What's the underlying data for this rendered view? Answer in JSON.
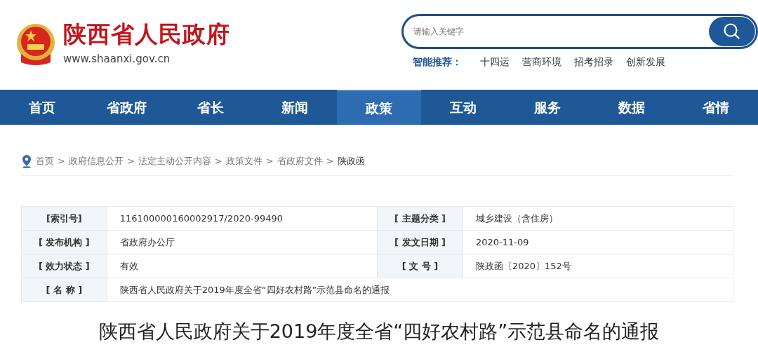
{
  "header": {
    "site_name": "陕西省人民政府",
    "url": "www.shaanxi.gov.cn"
  },
  "search": {
    "placeholder": "请输入关键字"
  },
  "recommend": {
    "label": "智能推荐：",
    "items": [
      "十四运",
      "营商环境",
      "招考招录",
      "创新发展"
    ]
  },
  "nav": [
    {
      "label": "首页",
      "selected": false
    },
    {
      "label": "省政府",
      "selected": false
    },
    {
      "label": "省长",
      "selected": false
    },
    {
      "label": "新闻",
      "selected": false
    },
    {
      "label": "政策",
      "selected": true
    },
    {
      "label": "互动",
      "selected": false
    },
    {
      "label": "服务",
      "selected": false
    },
    {
      "label": "数据",
      "selected": false
    },
    {
      "label": "省情",
      "selected": false
    }
  ],
  "breadcrumb_separator": ">",
  "breadcrumb": [
    "首页",
    "政府信息公开",
    "法定主动公开内容",
    "政策文件",
    "省政府文件",
    "陕政函"
  ],
  "info_table": [
    [
      {
        "label": "[索引号]",
        "value": "116100000160002917/2020-99490"
      },
      {
        "label": "[ 主题分类 ]",
        "value": "城乡建设（含住房）"
      }
    ],
    [
      {
        "label": "[ 发布机构 ]",
        "value": "省政府办公厅"
      },
      {
        "label": "[ 发文日期 ]",
        "value": "2020-11-09"
      }
    ],
    [
      {
        "label": "[ 效力状态 ]",
        "value": "有效"
      },
      {
        "label": "[ 文 号 ]",
        "value": "陕政函〔2020〕152号"
      }
    ],
    [
      {
        "label": "[ 名 称 ]",
        "value": "陕西省人民政府关于2019年度全省“四好农村路”示范县命名的通报"
      }
    ]
  ],
  "title": "陕西省人民政府关于2019年度全省“四好农村路”示范县命名的通报"
}
